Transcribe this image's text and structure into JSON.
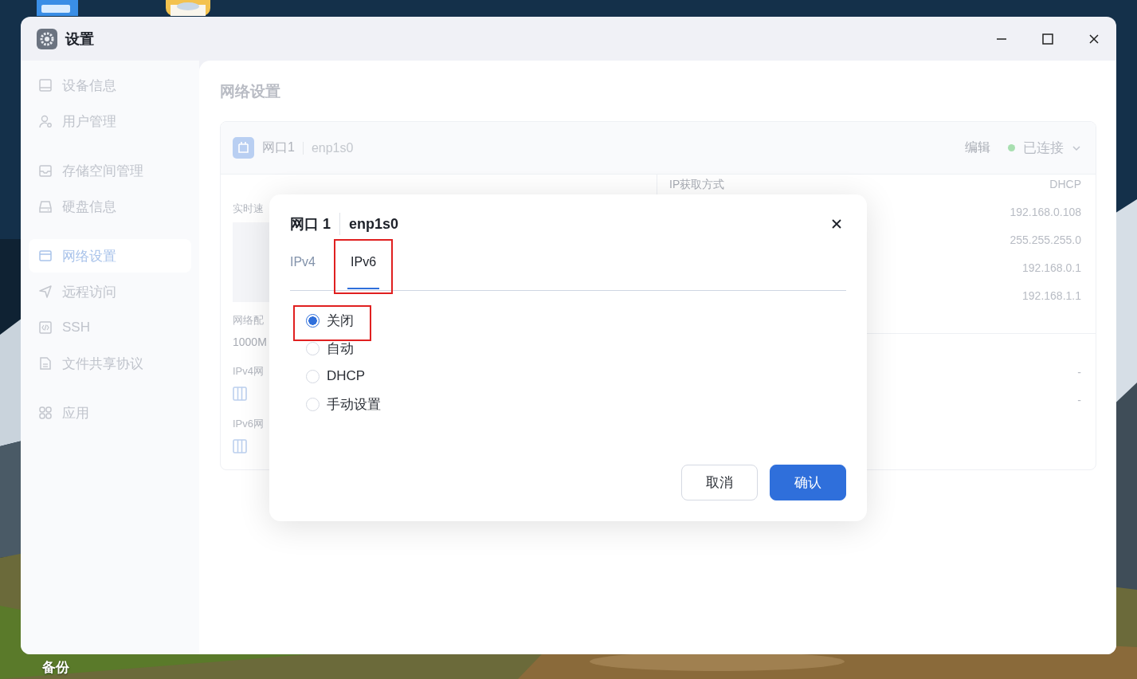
{
  "desktop": {
    "icon_labels": [
      "备份"
    ]
  },
  "window": {
    "title": "设置"
  },
  "sidebar": {
    "groups": [
      {
        "items": [
          {
            "label": "设备信息",
            "selected": false
          },
          {
            "label": "用户管理",
            "selected": false
          }
        ]
      },
      {
        "items": [
          {
            "label": "存储空间管理",
            "selected": false
          },
          {
            "label": "硬盘信息",
            "selected": false
          }
        ]
      },
      {
        "items": [
          {
            "label": "网络设置",
            "selected": true
          },
          {
            "label": "远程访问",
            "selected": false
          },
          {
            "label": "SSH",
            "selected": false
          },
          {
            "label": "文件共享协议",
            "selected": false
          }
        ]
      },
      {
        "items": [
          {
            "label": "应用",
            "selected": false
          }
        ]
      }
    ]
  },
  "page": {
    "heading": "网络设置"
  },
  "card": {
    "port_name": "网口1",
    "interface": "enp1s0",
    "edit_link": "编辑",
    "status": "已连接",
    "left": {
      "speed_label": "实时速",
      "config_label": "网络配",
      "config_value": "1000M",
      "ipv4_label": "IPv4网",
      "ipv6_label": "IPv6网"
    },
    "right_groups": [
      {
        "rows": [
          {
            "label": "IP获取方式",
            "value": "DHCP"
          },
          {
            "value": "192.168.0.108"
          },
          {
            "value": "255.255.255.0"
          },
          {
            "value": "192.168.0.1"
          },
          {
            "value": "192.168.1.1"
          }
        ]
      },
      {
        "rows": [
          {
            "value": "-"
          },
          {
            "value": "-"
          }
        ]
      }
    ]
  },
  "dialog": {
    "title": "网口 1",
    "subtitle": "enp1s0",
    "tabs": [
      {
        "label": "IPv4",
        "selected": false,
        "highlighted": false
      },
      {
        "label": "IPv6",
        "selected": true,
        "highlighted": true
      }
    ],
    "options": [
      {
        "label": "关闭",
        "selected": true,
        "highlighted": true
      },
      {
        "label": "自动",
        "selected": false,
        "highlighted": false
      },
      {
        "label": "DHCP",
        "selected": false,
        "highlighted": false
      },
      {
        "label": "手动设置",
        "selected": false,
        "highlighted": false
      }
    ],
    "buttons": [
      {
        "label": "取消",
        "kind": "secondary"
      },
      {
        "label": "确认",
        "kind": "primary"
      }
    ]
  }
}
